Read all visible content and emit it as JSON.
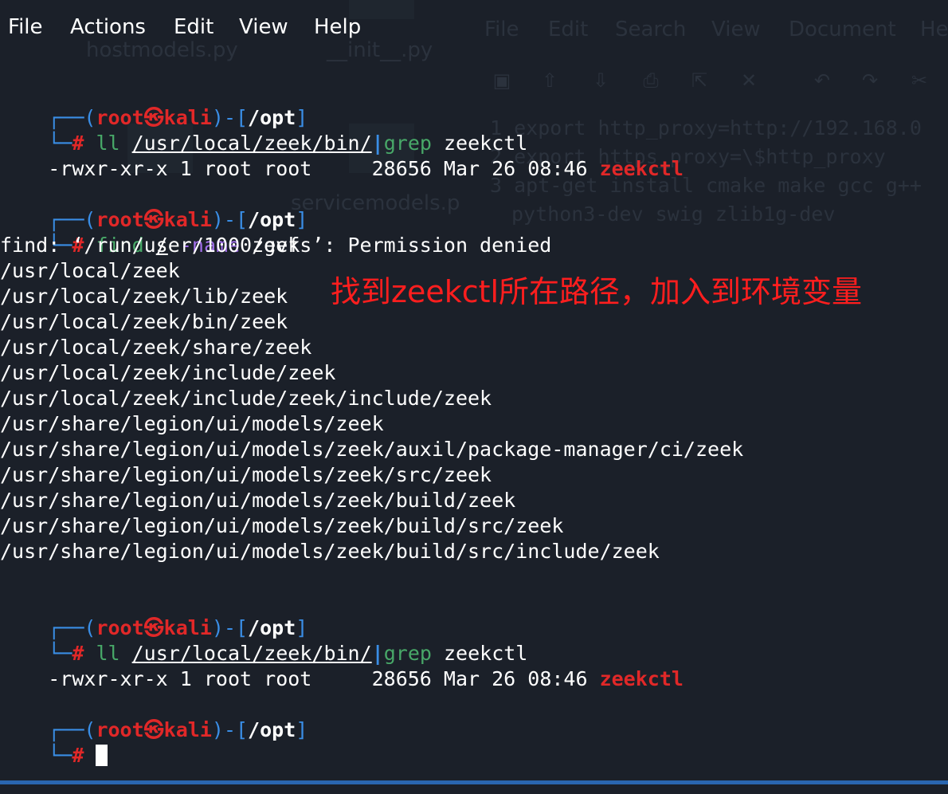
{
  "menu": [
    "File",
    "Actions",
    "Edit",
    "View",
    "Help"
  ],
  "background_window": {
    "menu": [
      "File",
      "Edit",
      "Search",
      "View",
      "Document",
      "He"
    ],
    "files": [
      "hostmodels.py",
      "__init__.py",
      "servicemodels.p"
    ],
    "code_lines": [
      {
        "no": "1",
        "text": "export http_proxy=http://192.168.0"
      },
      {
        "no": "2",
        "text": "export https_proxy=\\$http_proxy"
      },
      {
        "no": "3",
        "text": "apt-get install cmake make gcc g++"
      },
      {
        "no": "",
        "text": "python3-dev swig zlib1g-dev"
      }
    ]
  },
  "prompt": {
    "open": "┌──(",
    "user": "root",
    "skull": "㉿",
    "host": "kali",
    "mid": ")-[",
    "dir": "/opt",
    "close": "]",
    "corner": "└─",
    "hash": "#"
  },
  "cmd1": {
    "a": "ll",
    "path": "/usr/local/zeek/bin/",
    "pipe": "|",
    "b": "grep",
    "c": "zeekctl"
  },
  "ls_line": {
    "text": "-rwxr-xr-x 1 root root     28656 Mar 26 08:46 ",
    "name": "zeekctl"
  },
  "cmd2": {
    "a": "find",
    "b": "/",
    "c": "-name",
    "d": "zeek"
  },
  "find_output": [
    "find: ‘/run/user/1000/gvfs’: Permission denied",
    "/usr/local/zeek",
    "/usr/local/zeek/lib/zeek",
    "/usr/local/zeek/bin/zeek",
    "/usr/local/zeek/share/zeek",
    "/usr/local/zeek/include/zeek",
    "/usr/local/zeek/include/zeek/include/zeek",
    "/usr/share/legion/ui/models/zeek",
    "/usr/share/legion/ui/models/zeek/auxil/package-manager/ci/zeek",
    "/usr/share/legion/ui/models/zeek/src/zeek",
    "/usr/share/legion/ui/models/zeek/build/zeek",
    "/usr/share/legion/ui/models/zeek/build/src/zeek",
    "/usr/share/legion/ui/models/zeek/build/src/include/zeek"
  ],
  "annotation": "找到zeekctl所在路径，加入到环境变量",
  "colors": {
    "bg": "#1b2029",
    "prompt_blue": "#3a8ee6",
    "prompt_red": "#e12828",
    "cmd_green": "#48a868",
    "annotation_red": "#ff1e1e"
  }
}
